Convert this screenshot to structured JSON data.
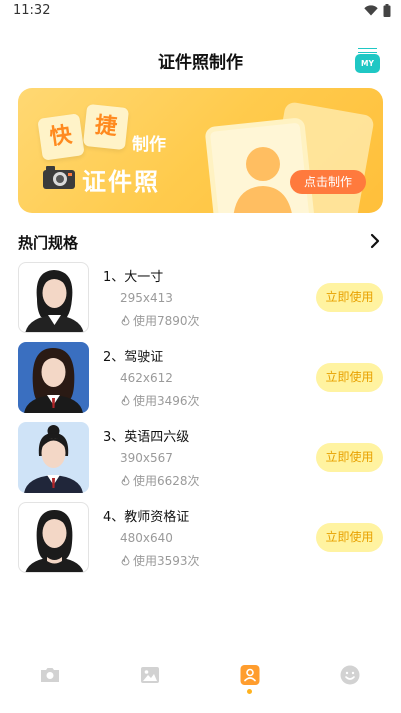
{
  "status_bar": {
    "time": "11:32"
  },
  "header": {
    "title": "证件照制作",
    "my_label": "MY"
  },
  "banner": {
    "tile_1": "快",
    "tile_2": "捷",
    "make_label": "制作",
    "big_text": "证件照",
    "button_label": "点击制作",
    "colors": {
      "accent": "#ff7a3d",
      "background": "#ffcb4d"
    }
  },
  "section": {
    "title": "热门规格"
  },
  "specs": [
    {
      "name": "1、大一寸",
      "size": "295x413",
      "uses": "使用7890次",
      "button": "立即使用"
    },
    {
      "name": "2、驾驶证",
      "size": "462x612",
      "uses": "使用3496次",
      "button": "立即使用"
    },
    {
      "name": "3、英语四六级",
      "size": "390x567",
      "uses": "使用6628次",
      "button": "立即使用"
    },
    {
      "name": "4、教师资格证",
      "size": "480x640",
      "uses": "使用3593次",
      "button": "立即使用"
    }
  ],
  "tab_bar": {
    "tabs": [
      "camera-icon",
      "image-icon",
      "person-card-icon",
      "smiley-icon"
    ],
    "active_color": "#ff9d2e"
  }
}
